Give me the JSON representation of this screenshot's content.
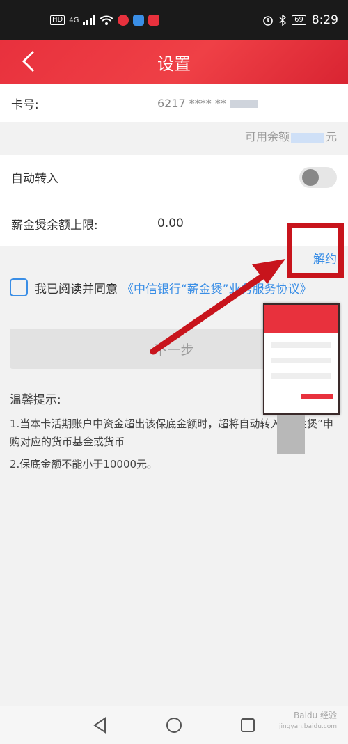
{
  "statusbar": {
    "hd_badge": "HD",
    "network": "4G",
    "time": "8:29",
    "battery": "69"
  },
  "header": {
    "title": "设置",
    "background_color": "#e8313d"
  },
  "card": {
    "label": "卡号:",
    "number": "6217 **** **"
  },
  "balance": {
    "prefix": "可用余额",
    "suffix": "元"
  },
  "settings": {
    "auto_transfer_label": "自动转入",
    "auto_transfer_on": false,
    "limit_label": "薪金煲余额上限:",
    "limit_value": "0.00"
  },
  "unbind_label": "解约",
  "agreement": {
    "prefix": "我已阅读并同意",
    "link": "《中信银行“薪金煲”业务服务协议》"
  },
  "next_button": "下一步",
  "tips": {
    "title": "温馨提示:",
    "items": [
      "1.当本卡活期账户中资金超出该保底金额时，超将自动转入“薪金煲”申购对应的货币基金或货币",
      "2.保底金额不能小于10000元。"
    ]
  },
  "watermark": {
    "line1": "Baidu 经验",
    "line2": "jingyan.baidu.com"
  },
  "colors": {
    "accent": "#3a8ee6",
    "annotation": "#c8141c"
  }
}
